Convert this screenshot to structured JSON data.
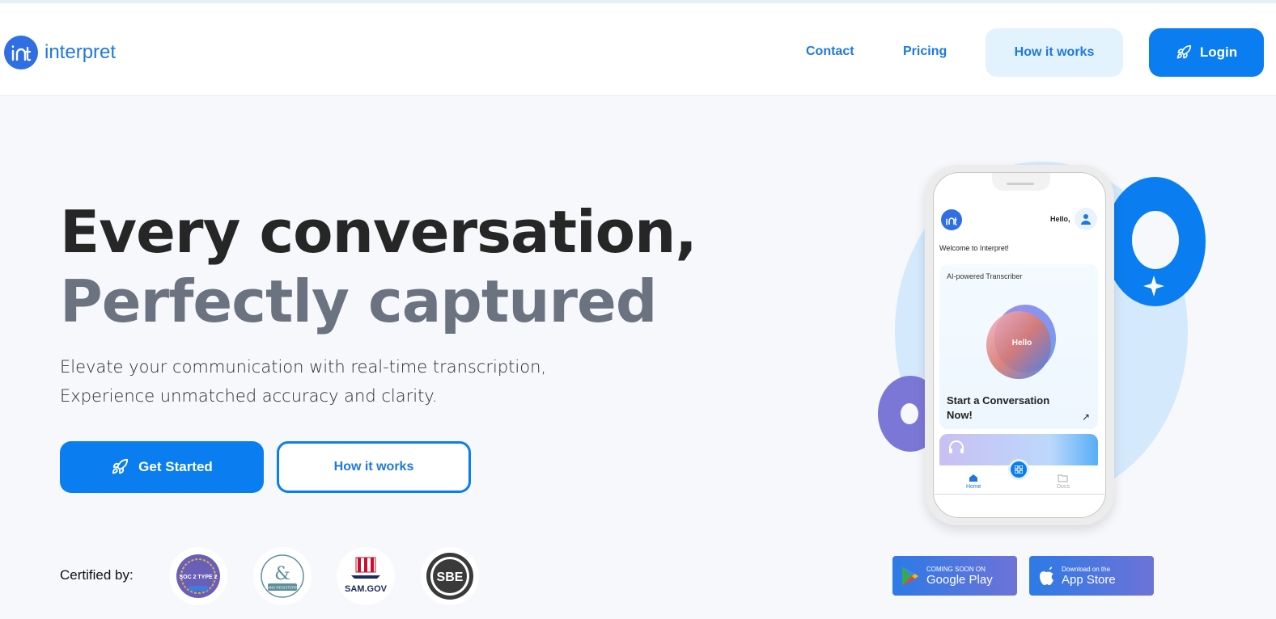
{
  "header": {
    "logo_text": "interpret",
    "nav": {
      "contact": "Contact",
      "pricing": "Pricing",
      "how_it_works": "How it works",
      "login": "Login"
    }
  },
  "hero": {
    "title_line1": "Every conversation,",
    "title_line2": "Perfectly captured",
    "subtitle_line1": "Elevate your communication with real-time transcription,",
    "subtitle_line2": "Experience unmatched accuracy and clarity.",
    "primary_button": "Get Started",
    "secondary_button": "How it works"
  },
  "certifications": {
    "label": "Certified by:",
    "badges": [
      {
        "name": "SOC 2 TYPE 2",
        "text": "SOC 2 TYPE 2"
      },
      {
        "name": "D-U-N-S Registered",
        "text": "DUNS REGISTERED"
      },
      {
        "name": "SAM.GOV",
        "text": "SAM.GOV"
      },
      {
        "name": "SBE Certified",
        "text": "SBE"
      }
    ]
  },
  "stores": {
    "google_play": {
      "small": "COMING SOON ON",
      "big": "Google Play"
    },
    "app_store": {
      "small": "Download on the",
      "big": "App Store"
    }
  },
  "phone": {
    "greeting": "Hello,",
    "welcome": "Welcome to Interpret!",
    "card_label": "AI-powered Transcriber",
    "orb_text": "Hello",
    "cta": "Start a Conversation Now!",
    "tabs": {
      "home": "Home",
      "docs": "Docs"
    }
  },
  "colors": {
    "primary": "#0a7ef0",
    "title_dark": "#262626",
    "title_gray": "#6b7280",
    "accent_purple": "#7b77d6",
    "light_blue": "#e2f3fd"
  }
}
